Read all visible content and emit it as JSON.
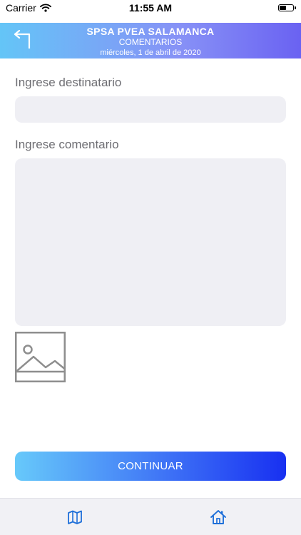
{
  "status_bar": {
    "carrier": "Carrier",
    "time": "11:55 AM"
  },
  "header": {
    "title": "SPSA PVEA SALAMANCA",
    "subtitle": "COMENTARIOS",
    "date": "miércoles, 1 de abril de 2020"
  },
  "form": {
    "recipient_label": "Ingrese destinatario",
    "recipient_value": "",
    "comment_label": "Ingrese comentario",
    "comment_value": "",
    "continue_label": "CONTINUAR"
  },
  "icons": {
    "back": "back-arrow-icon",
    "image": "image-placeholder-icon",
    "map": "map-icon",
    "home": "home-icon",
    "wifi": "wifi-icon",
    "battery": "battery-icon"
  },
  "colors": {
    "header_gradient_start": "#64c5f7",
    "header_gradient_end": "#6a62f2",
    "button_gradient_start": "#67c9fa",
    "button_gradient_end": "#1830f1",
    "input_background": "#efeff4",
    "tab_icon": "#1e6fd9"
  }
}
